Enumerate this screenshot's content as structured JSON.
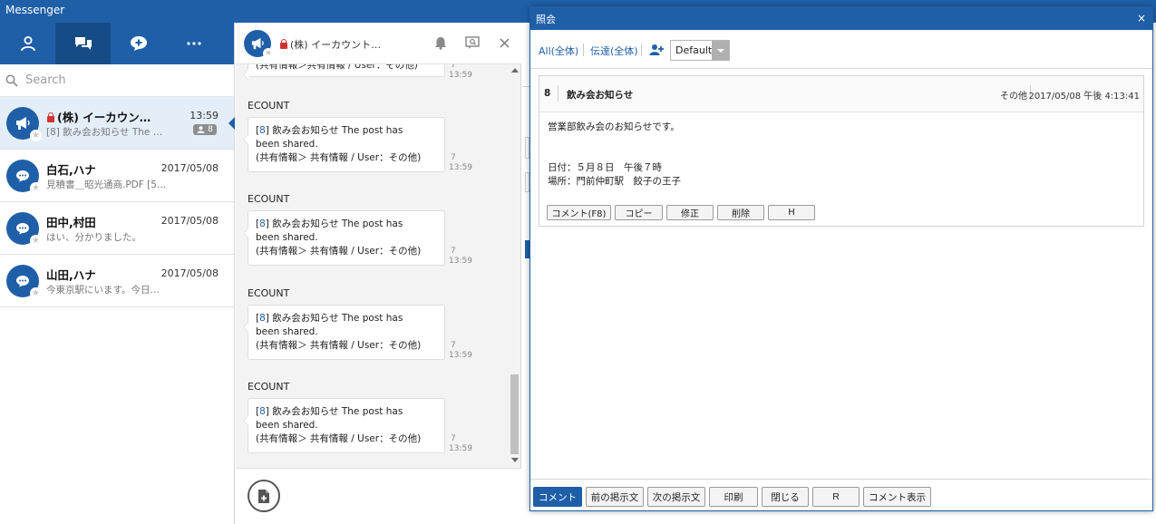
{
  "app": {
    "title": "Messenger"
  },
  "colors": {
    "brand": "#1f5fa8",
    "brand_dark": "#174b86",
    "lock": "#d23232",
    "selected_row": "#e4eef9"
  },
  "sidebar": {
    "tabs": [
      {
        "name": "contacts",
        "icon": "person-icon"
      },
      {
        "name": "chats",
        "icon": "chat-bubbles-icon",
        "active": true
      },
      {
        "name": "new-chat",
        "icon": "chat-add-icon"
      },
      {
        "name": "more",
        "icon": "more-icon"
      }
    ],
    "search": {
      "placeholder": "Search"
    },
    "chats": [
      {
        "name": "(株) イーカウン…",
        "date": "13:59",
        "preview": "[8] 飲み会お知らせ The …",
        "member_count": "8",
        "locked": true
      },
      {
        "name": "白石,ハナ",
        "date": "2017/05/08",
        "preview": "見積書＿昭光通商.PDF [5…"
      },
      {
        "name": "田中,村田",
        "date": "2017/05/08",
        "preview": "はい、分かりました。"
      },
      {
        "name": "山田,ハナ",
        "date": "2017/05/08",
        "preview": "今東京駅にいます。今日か…"
      }
    ]
  },
  "chat": {
    "title": "(株) イーカウント…",
    "top_fragment": {
      "text": "(共有情報＞共有情報 / User：その他)",
      "read": "7",
      "time": "13:59"
    },
    "messages": [
      {
        "sender": "ECOUNT",
        "link": "8",
        "line1_pre": "[",
        "line1_post": "] 飲み会お知らせ The post has",
        "line2": "been shared.",
        "line3": "(共有情報＞ 共有情報 / User：その他)",
        "read": "7",
        "time": "13:59"
      },
      {
        "sender": "ECOUNT",
        "link": "8",
        "line1_pre": "[",
        "line1_post": "] 飲み会お知らせ The post has",
        "line2": "been shared.",
        "line3": "(共有情報＞ 共有情報 / User：その他)",
        "read": "7",
        "time": "13:59"
      },
      {
        "sender": "ECOUNT",
        "link": "8",
        "line1_pre": "[",
        "line1_post": "] 飲み会お知らせ The post has",
        "line2": "been shared.",
        "line3": "(共有情報＞ 共有情報 / User：その他)",
        "read": "7",
        "time": "13:59"
      },
      {
        "sender": "ECOUNT",
        "link": "8",
        "line1_pre": "[",
        "line1_post": "] 飲み会お知らせ The post has",
        "line2": "been shared.",
        "line3": "(共有情報＞ 共有情報 / User：その他)",
        "read": "7",
        "time": "13:59"
      }
    ]
  },
  "dialog": {
    "title": "照会",
    "close": "×",
    "toolbar": {
      "all": "All(全体)",
      "forward": "伝達(全体)",
      "dropdown": "Default"
    },
    "post": {
      "number": "8",
      "title": "飲み会お知らせ",
      "category": "その他",
      "datetime": "2017/05/08 午後 4:13:41",
      "body_line1": "営業部飲み会のお知らせです。",
      "body_line2": "日付：５月８日　午後７時",
      "body_line3": "場所：門前仲町駅　餃子の王子",
      "actions": [
        "コメント(F8)",
        "コピー",
        "修正",
        "削除",
        "H"
      ]
    },
    "footer": [
      "コメント",
      "前の掲示文",
      "次の掲示文",
      "印刷",
      "閉じる",
      "R",
      "コメント表示"
    ]
  }
}
